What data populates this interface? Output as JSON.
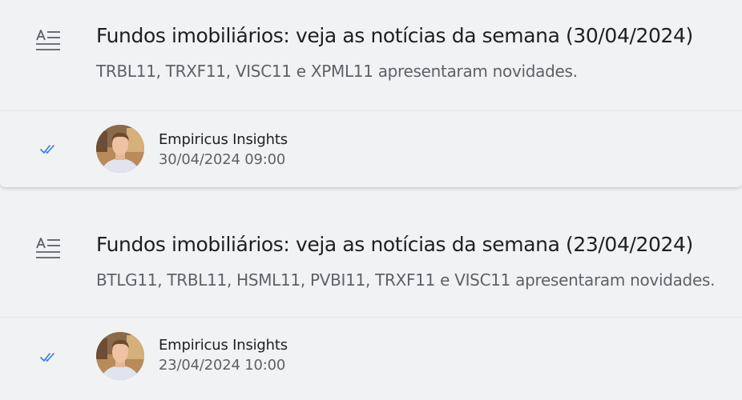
{
  "posts": [
    {
      "title": "Fundos imobiliários: veja as notícias da semana (30/04/2024)",
      "description": "TRBL11, TRXF11, VISC11 e XPML11 apresentaram novidades.",
      "author": "Empiricus Insights",
      "datetime": "30/04/2024 09:00",
      "article_icon": "article-icon",
      "read_icon": "double-check-icon"
    },
    {
      "title": "Fundos imobiliários: veja as notícias da semana (23/04/2024)",
      "description": "BTLG11, TRBL11, HSML11, PVBI11, TRXF11 e VISC11 apresentaram novidades.",
      "author": "Empiricus Insights",
      "datetime": "23/04/2024 10:00",
      "article_icon": "article-icon",
      "read_icon": "double-check-icon"
    }
  ],
  "colors": {
    "background": "#f1f2f4",
    "title": "#1f1f22",
    "secondary_text": "#5f6166",
    "read_check": "#2f7fe0",
    "icon": "#5c5f66"
  }
}
